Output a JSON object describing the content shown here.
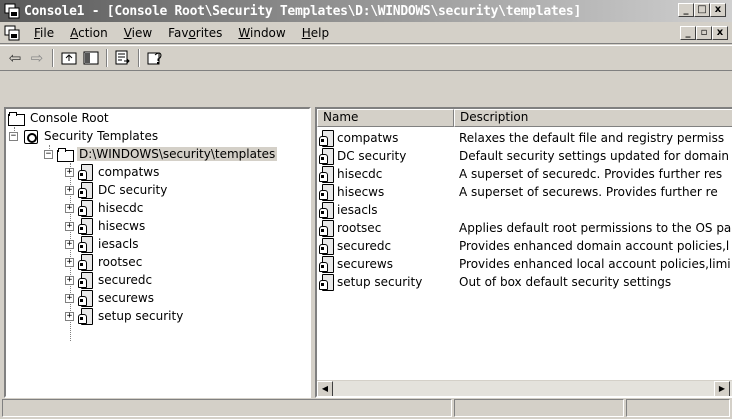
{
  "window": {
    "title": "Console1 - [Console Root\\Security Templates\\D:\\WINDOWS\\security\\templates]",
    "minimize": "_",
    "maximize": "□",
    "close": "x"
  },
  "menu": [
    {
      "label": "File",
      "key": "F",
      "rest": "ile"
    },
    {
      "label": "Action",
      "key": "A",
      "rest": "ction"
    },
    {
      "label": "View",
      "key": "V",
      "rest": "iew"
    },
    {
      "label": "Favorites",
      "pre": "Fav",
      "key": "o",
      "rest": "rites"
    },
    {
      "label": "Window",
      "key": "W",
      "rest": "indow"
    },
    {
      "label": "Help",
      "key": "H",
      "rest": "elp"
    }
  ],
  "mdi": {
    "minimize": "_",
    "restore": "▫",
    "close": "x"
  },
  "toolbar": {
    "back": "⇦",
    "forward": "⇨"
  },
  "tree": {
    "root": "Console Root",
    "security_templates": "Security Templates",
    "path_node": "D:\\WINDOWS\\security\\templates",
    "templates": [
      "compatws",
      "DC security",
      "hisecdc",
      "hisecws",
      "iesacls",
      "rootsec",
      "securedc",
      "securews",
      "setup security"
    ]
  },
  "list": {
    "columns": [
      "Name",
      "Description"
    ],
    "rows": [
      {
        "name": "compatws",
        "description": "Relaxes the default file and registry permiss"
      },
      {
        "name": "DC security",
        "description": "Default security settings updated for domain"
      },
      {
        "name": "hisecdc",
        "description": "A superset of securedc. Provides further res"
      },
      {
        "name": "hisecws",
        "description": "A superset of securews. Provides further re"
      },
      {
        "name": "iesacls",
        "description": ""
      },
      {
        "name": "rootsec",
        "description": "Applies default root permissions to the OS pa"
      },
      {
        "name": "securedc",
        "description": "Provides enhanced domain account policies,l"
      },
      {
        "name": "securews",
        "description": "Provides enhanced local account policies,limi"
      },
      {
        "name": "setup security",
        "description": "Out of box default security settings"
      }
    ]
  },
  "scrollbar": {
    "left": "◀",
    "right": "▶"
  }
}
